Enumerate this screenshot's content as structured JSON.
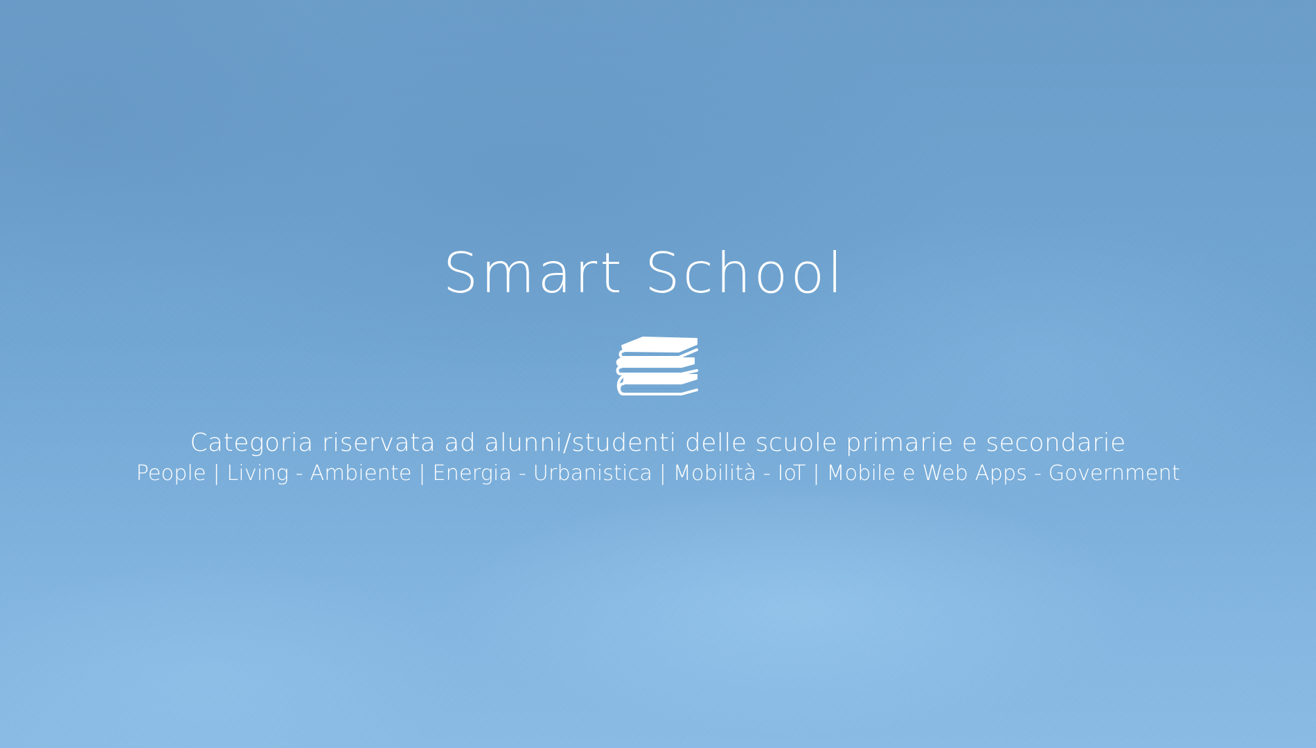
{
  "slide": {
    "title": "Smart School",
    "icon": "books-stack-icon",
    "subtitle": "Categoria riservata ad alunni/studenti delle scuole primarie e secondarie",
    "categories": "People | Living - Ambiente | Energia - Urbanistica | Mobilità - IoT | Mobile e Web Apps - Government"
  },
  "colors": {
    "background": "#72a6d2",
    "text": "#ffffff"
  }
}
